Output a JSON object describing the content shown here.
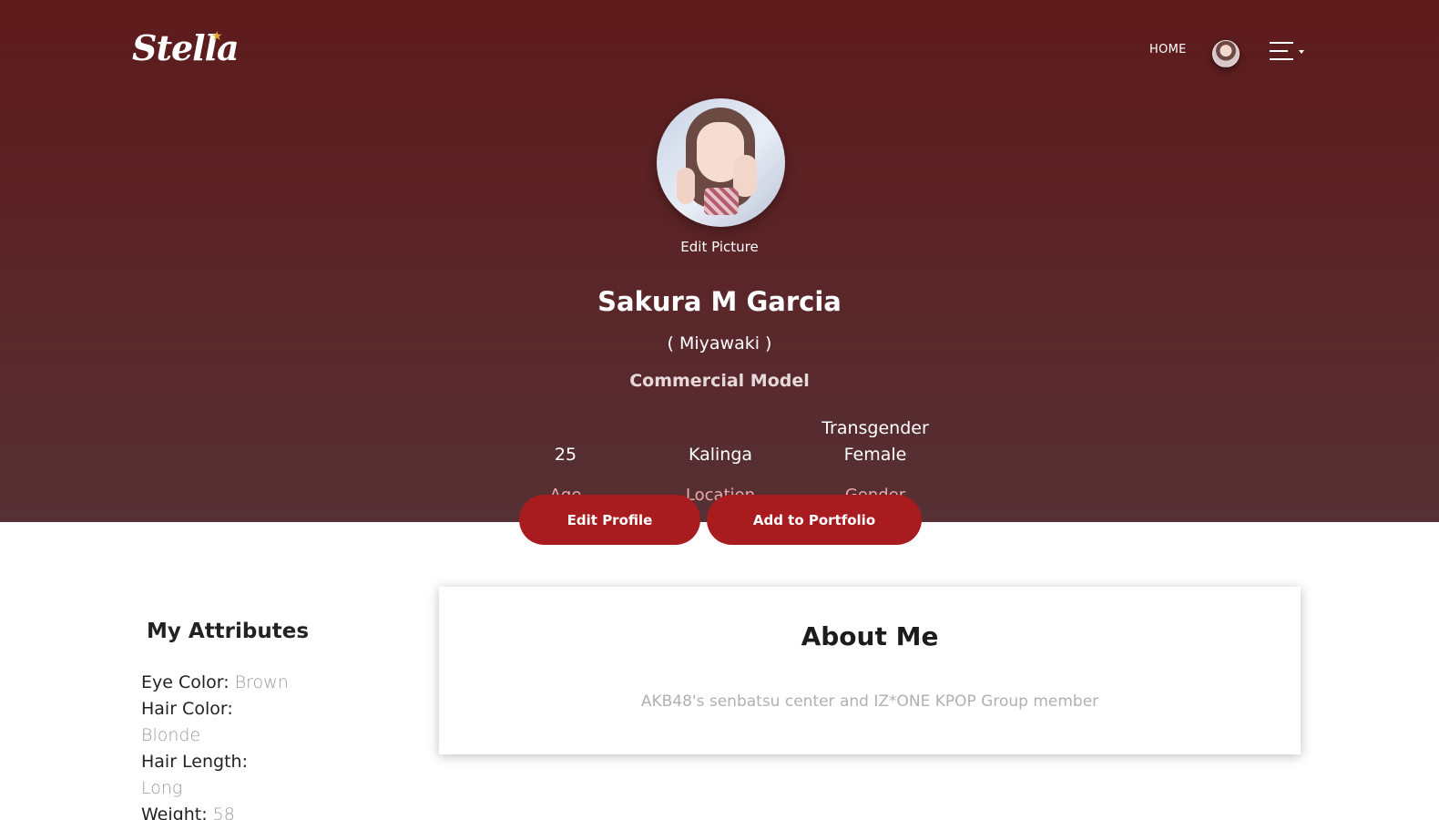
{
  "header": {
    "logo_text": "Stella",
    "nav_home_label": "HOME",
    "avatar_icon": "user-avatar-icon",
    "menu_icon": "hamburger-menu-icon"
  },
  "profile": {
    "edit_picture_label": "Edit Picture",
    "full_name": "Sakura M Garcia",
    "nickname": "( Miyawaki )",
    "profession": "Commercial Model",
    "stats": [
      {
        "value": "25",
        "label": "Age"
      },
      {
        "value": "Kalinga",
        "label": "Location"
      },
      {
        "value_line1": "Transgender",
        "value_line2": "Female",
        "label": "Gender"
      }
    ],
    "buttons": {
      "edit_profile": "Edit Profile",
      "add_to_portfolio": "Add to Portfolio"
    }
  },
  "attributes": {
    "title": "My Attributes",
    "items": [
      {
        "key": "Eye Color:",
        "value": "Brown"
      },
      {
        "key": "Hair Color:",
        "value": "Blonde"
      },
      {
        "key": "Hair Length:",
        "value": "Long"
      },
      {
        "key": "Weight:",
        "value": "58"
      }
    ]
  },
  "about": {
    "title": "About Me",
    "text": "AKB48's senbatsu center and IZ*ONE KPOP Group member"
  },
  "colors": {
    "hero_top": "#5e1b1c",
    "hero_bottom": "#553034",
    "button": "#a81c1f",
    "stat_label": "#f0a7ab",
    "logo_star": "#e2a72f"
  }
}
